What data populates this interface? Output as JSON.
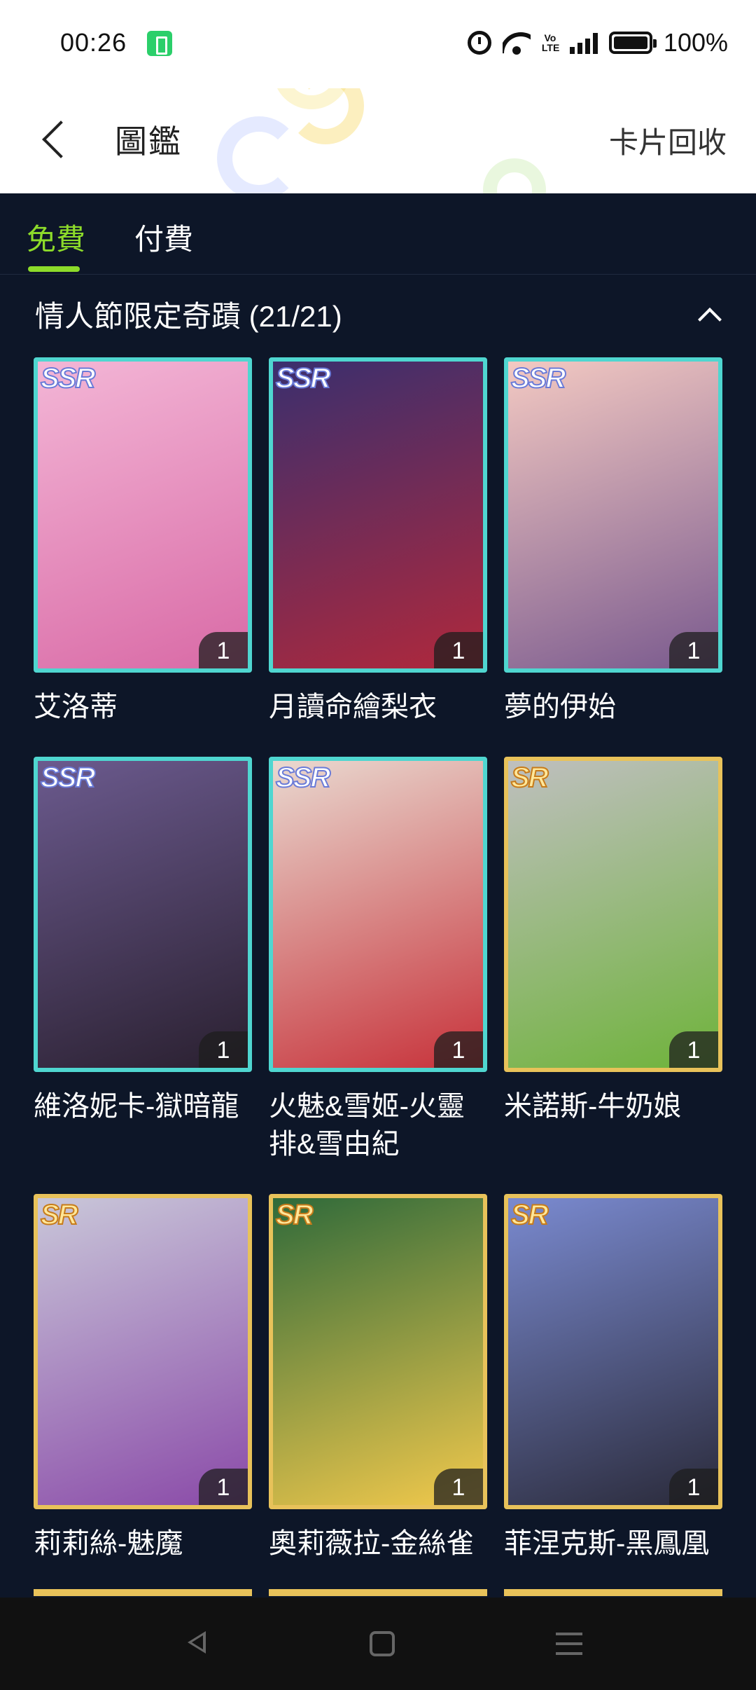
{
  "status_bar": {
    "time": "00:26",
    "battery_percent": "100%",
    "volte": "Vo LTE"
  },
  "header": {
    "title": "圖鑑",
    "right_action": "卡片回收"
  },
  "tabs": [
    {
      "label": "免費",
      "active": true
    },
    {
      "label": "付費",
      "active": false
    }
  ],
  "section": {
    "title": "情人節限定奇蹟 (21/21)"
  },
  "cards": [
    {
      "name": "艾洛蒂",
      "rarity": "SSR",
      "count": "1",
      "palette": [
        "#f3b6d6",
        "#d96aa6"
      ]
    },
    {
      "name": "月讀命繪梨衣",
      "rarity": "SSR",
      "count": "1",
      "palette": [
        "#3a2f6e",
        "#b0283c"
      ]
    },
    {
      "name": "夢的伊始",
      "rarity": "SSR",
      "count": "1",
      "palette": [
        "#f3c9c2",
        "#7a5a8e"
      ]
    },
    {
      "name": "維洛妮卡-獄暗龍",
      "rarity": "SSR",
      "count": "1",
      "palette": [
        "#6b5a8e",
        "#2a2030"
      ]
    },
    {
      "name": "火魅&雪姬-火靈排&雪由紀",
      "rarity": "SSR",
      "count": "1",
      "palette": [
        "#e9d9d0",
        "#c7323a"
      ]
    },
    {
      "name": "米諾斯-牛奶娘",
      "rarity": "SR",
      "count": "1",
      "palette": [
        "#bfbfbf",
        "#6fb33b"
      ]
    },
    {
      "name": "莉莉絲-魅魔",
      "rarity": "SR",
      "count": "1",
      "palette": [
        "#c9c7d9",
        "#8a4aa8"
      ]
    },
    {
      "name": "奧莉薇拉-金絲雀",
      "rarity": "SR",
      "count": "1",
      "palette": [
        "#2f6a3a",
        "#f2c94c"
      ]
    },
    {
      "name": "菲涅克斯-黑鳳凰",
      "rarity": "SR",
      "count": "1",
      "palette": [
        "#7a8ad0",
        "#2a2a3a"
      ]
    }
  ]
}
